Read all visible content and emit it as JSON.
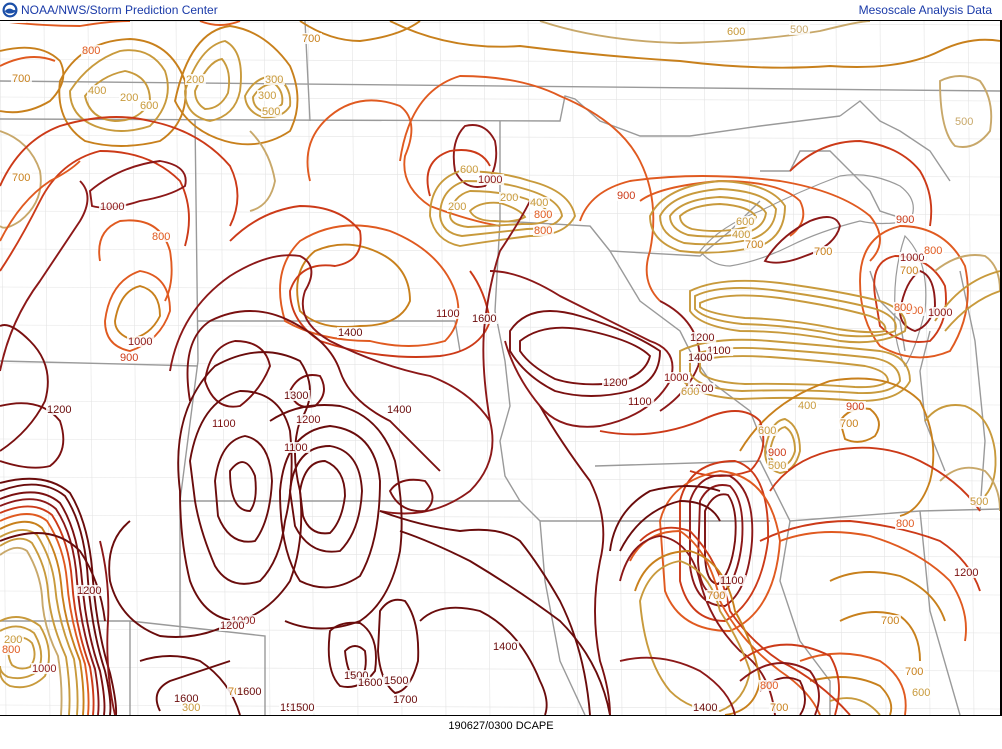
{
  "header": {
    "org_title": "NOAA/NWS/Storm Prediction Center",
    "product_title": "Mesoscale Analysis Data",
    "logo_icon": "noaa-logo-icon"
  },
  "footer": {
    "valid_label": "190627/0300 DCAPE"
  },
  "colors": {
    "c500": "#c8a86a",
    "c600": "#c89a3c",
    "c700": "#c8801c",
    "c800": "#e05a20",
    "c900": "#cc3a18",
    "c1000": "#8c1818",
    "c1100": "#7a1010",
    "high": "#6a0c0c",
    "state_border": "#9a9a9a",
    "county_border": "#e4e4e4",
    "label": "#000000"
  },
  "contour_labels": [
    {
      "text": "800",
      "level": "c800"
    },
    {
      "text": "700",
      "level": "c700"
    },
    {
      "text": "700",
      "level": "c700"
    },
    {
      "text": "600",
      "level": "c600"
    },
    {
      "text": "500",
      "level": "c500"
    },
    {
      "text": "500",
      "level": "c500"
    },
    {
      "text": "400",
      "level": "c600"
    },
    {
      "text": "200",
      "level": "c600"
    },
    {
      "text": "300",
      "level": "c600"
    },
    {
      "text": "200",
      "level": "c600"
    },
    {
      "text": "600",
      "level": "c600"
    },
    {
      "text": "300",
      "level": "c600"
    },
    {
      "text": "500",
      "level": "c600"
    },
    {
      "text": "700",
      "level": "c700"
    },
    {
      "text": "1000",
      "level": "c1000"
    },
    {
      "text": "800",
      "level": "c800"
    },
    {
      "text": "1000",
      "level": "c1000"
    },
    {
      "text": "900",
      "level": "c900"
    },
    {
      "text": "200",
      "level": "c600"
    },
    {
      "text": "200",
      "level": "c600"
    },
    {
      "text": "400",
      "level": "c600"
    },
    {
      "text": "800",
      "level": "c800"
    },
    {
      "text": "800",
      "level": "c800"
    },
    {
      "text": "600",
      "level": "c600"
    },
    {
      "text": "1000",
      "level": "c1000"
    },
    {
      "text": "900",
      "level": "c900"
    },
    {
      "text": "600",
      "level": "c600"
    },
    {
      "text": "400",
      "level": "c600"
    },
    {
      "text": "700",
      "level": "c700"
    },
    {
      "text": "900",
      "level": "c900"
    },
    {
      "text": "1000",
      "level": "c1000"
    },
    {
      "text": "800",
      "level": "c800"
    },
    {
      "text": "700",
      "level": "c700"
    },
    {
      "text": "800",
      "level": "c800"
    },
    {
      "text": "700",
      "level": "c700"
    },
    {
      "text": "800",
      "level": "c800"
    },
    {
      "text": "1000",
      "level": "c1000"
    },
    {
      "text": "1100",
      "level": "c1100"
    },
    {
      "text": "1400",
      "level": "high"
    },
    {
      "text": "1200",
      "level": "high"
    },
    {
      "text": "1300",
      "level": "high"
    },
    {
      "text": "1100",
      "level": "c1100"
    },
    {
      "text": "1200",
      "level": "c1100"
    },
    {
      "text": "1100",
      "level": "c1100"
    },
    {
      "text": "1400",
      "level": "high"
    },
    {
      "text": "1600",
      "level": "high"
    },
    {
      "text": "1200",
      "level": "c1100"
    },
    {
      "text": "1100",
      "level": "c1100"
    },
    {
      "text": "1200",
      "level": "c1100"
    },
    {
      "text": "1000",
      "level": "c1000"
    },
    {
      "text": "1200",
      "level": "c1100"
    },
    {
      "text": "1100",
      "level": "c1100"
    },
    {
      "text": "1400",
      "level": "high"
    },
    {
      "text": "600",
      "level": "c600"
    },
    {
      "text": "400",
      "level": "c600"
    },
    {
      "text": "700",
      "level": "c700"
    },
    {
      "text": "900",
      "level": "c900"
    },
    {
      "text": "800",
      "level": "c800"
    },
    {
      "text": "500",
      "level": "c600"
    },
    {
      "text": "600",
      "level": "c600"
    },
    {
      "text": "900",
      "level": "c900"
    },
    {
      "text": "500",
      "level": "c600"
    },
    {
      "text": "700",
      "level": "c700"
    },
    {
      "text": "1200",
      "level": "c1100"
    },
    {
      "text": "1100",
      "level": "c1100"
    },
    {
      "text": "700",
      "level": "c700"
    },
    {
      "text": "1400",
      "level": "high"
    },
    {
      "text": "1200",
      "level": "c1100"
    },
    {
      "text": "1000",
      "level": "c1000"
    },
    {
      "text": "1200",
      "level": "c1100"
    },
    {
      "text": "700",
      "level": "c700"
    },
    {
      "text": "1600",
      "level": "high"
    },
    {
      "text": "1500",
      "level": "high"
    },
    {
      "text": "1500",
      "level": "high"
    },
    {
      "text": "1400",
      "level": "high"
    },
    {
      "text": "1500",
      "level": "high"
    },
    {
      "text": "1600",
      "level": "high"
    },
    {
      "text": "1500",
      "level": "high"
    },
    {
      "text": "1700",
      "level": "high"
    },
    {
      "text": "1600",
      "level": "high"
    },
    {
      "text": "300",
      "level": "c600"
    },
    {
      "text": "200",
      "level": "c600"
    },
    {
      "text": "800",
      "level": "c800"
    },
    {
      "text": "1000",
      "level": "c1000"
    },
    {
      "text": "700",
      "level": "c700"
    },
    {
      "text": "800",
      "level": "c800"
    },
    {
      "text": "700",
      "level": "c700"
    },
    {
      "text": "600",
      "level": "c600"
    },
    {
      "text": "1000",
      "level": "c1000"
    },
    {
      "text": "1100",
      "level": "c1100"
    },
    {
      "text": "700",
      "level": "c700"
    }
  ]
}
